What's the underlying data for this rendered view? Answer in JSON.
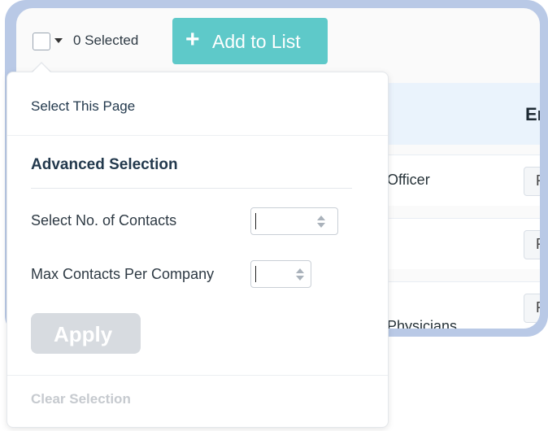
{
  "toolbar": {
    "selected_count": "0 Selected",
    "add_to_list": "Add to List",
    "add_icon": "+"
  },
  "table": {
    "header_partial": "Em",
    "rows": [
      {
        "text": "Officer",
        "chip": "F"
      },
      {
        "text": "",
        "chip": "F"
      },
      {
        "text": "Physicians",
        "chip": "F"
      }
    ]
  },
  "dropdown": {
    "select_this_page": "Select This Page",
    "advanced_title": "Advanced Selection",
    "select_no_contacts_label": "Select No. of Contacts",
    "max_contacts_label": "Max Contacts Per Company",
    "select_no_contacts_value": "",
    "max_contacts_value": "",
    "apply": "Apply",
    "clear": "Clear Selection"
  },
  "colors": {
    "frame": "#b9c9e6",
    "accent_button": "#5ec9c9",
    "disabled_button": "#d7dbe0",
    "table_header_bg": "#eaf3fc"
  }
}
